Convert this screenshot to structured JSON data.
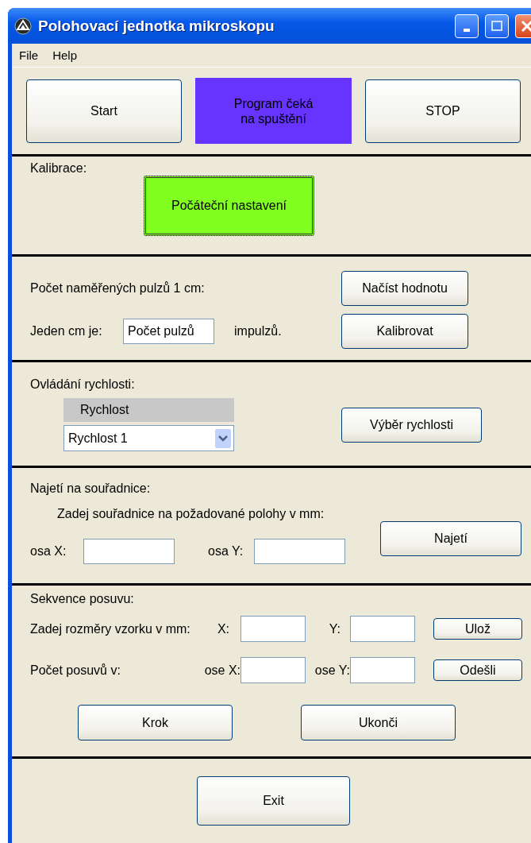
{
  "window": {
    "title": "Polohovací jednotka mikroskopu"
  },
  "menu": [
    {
      "label": "File"
    },
    {
      "label": "Help"
    }
  ],
  "top": {
    "start_button": "Start",
    "status_lines": [
      "Program čeká",
      "na spuštění"
    ],
    "stop_button": "STOP"
  },
  "calibration": {
    "label": "Kalibrace:",
    "button": "Počáteční nastavení"
  },
  "pulses": {
    "label": "Počet naměřených pulzů 1 cm:",
    "read_button": "Načíst hodnotu",
    "cm_label": "Jeden cm je:",
    "cm_value": "Počet pulzů",
    "unit": "impulzů.",
    "calibrate_button": "Kalibrovat"
  },
  "speed": {
    "label": "Ovládání rychlosti:",
    "group_title": "Rychlost",
    "selected_value": "Rychlost 1",
    "button": "Výběr rychlosti"
  },
  "move": {
    "label": "Najetí na souřadnice:",
    "hint": "Zadej souřadnice na požadované polohy v mm:",
    "x_label": "osa X:",
    "y_label": "osa Y:",
    "button": "Najetí"
  },
  "sequence": {
    "label": "Sekvence posuvu:",
    "size_label": "Zadej rozměry vzorku v mm:",
    "size_x_label": "X:",
    "size_y_label": "Y:",
    "save_button": "Ulož",
    "count_label": "Počet posuvů v:",
    "count_x_label": "ose X:",
    "count_y_label": "ose Y:",
    "send_button": "Odešli",
    "step_button": "Krok",
    "end_button": "Ukonči"
  },
  "exit_button": "Exit"
}
